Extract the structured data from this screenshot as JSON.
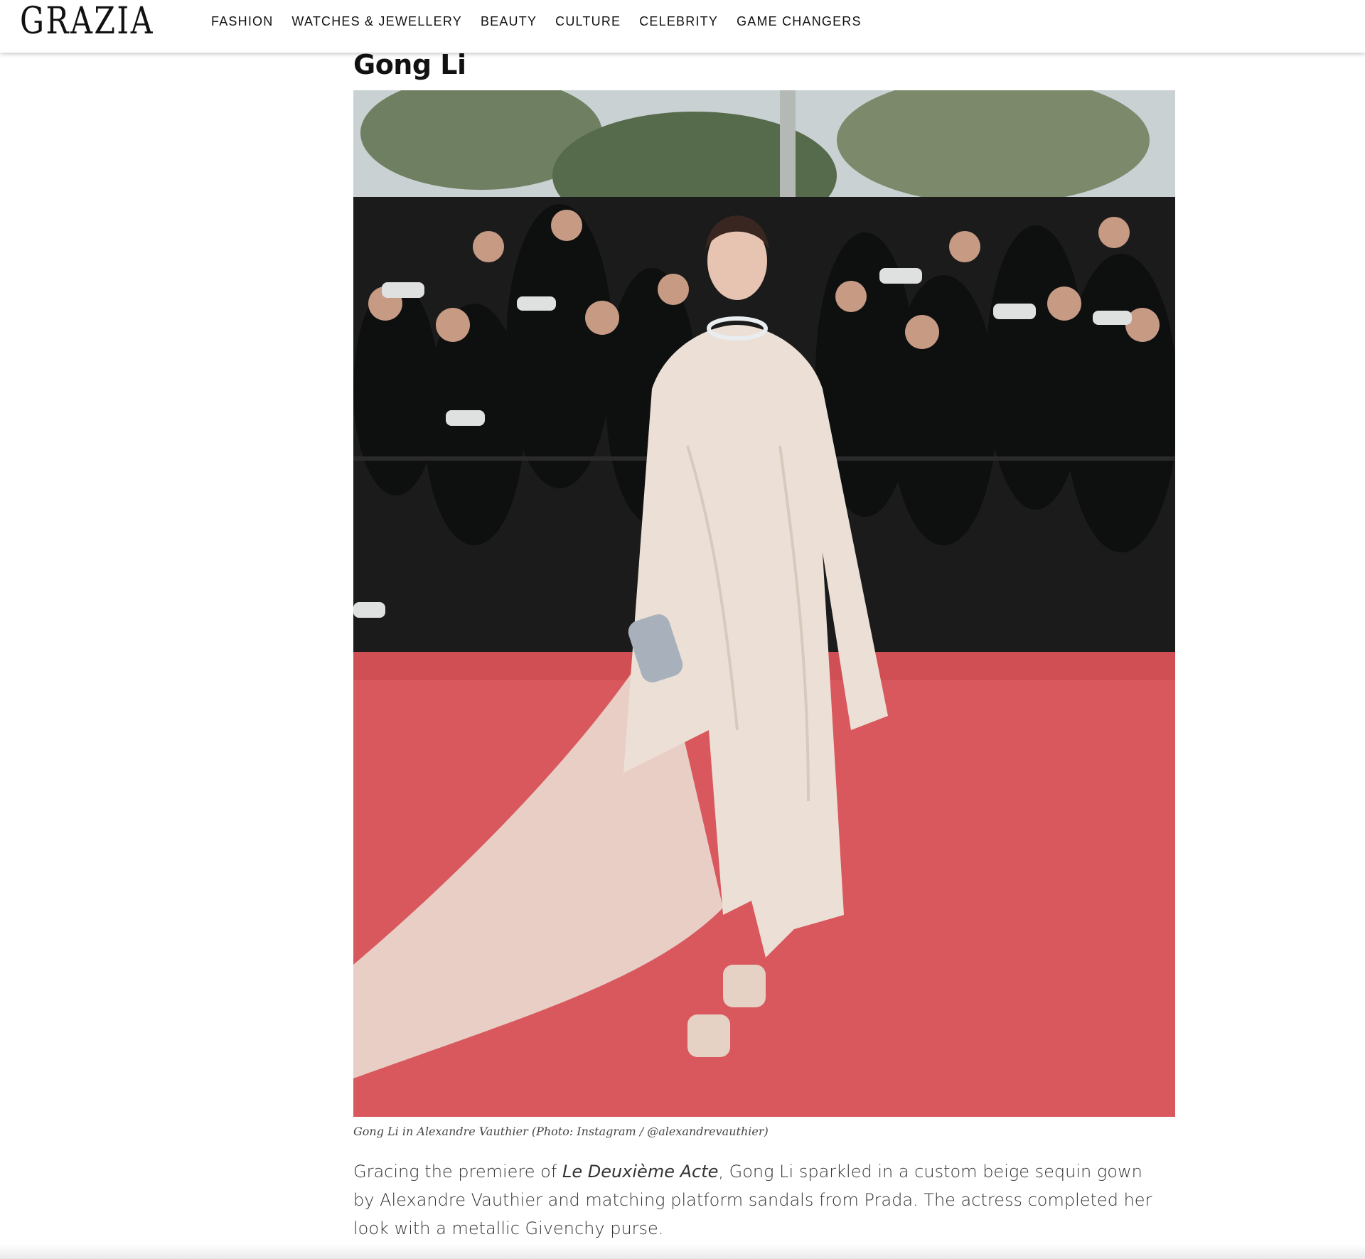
{
  "header": {
    "logo": "GRAZIA",
    "nav": [
      "FASHION",
      "WATCHES & JEWELLERY",
      "BEAUTY",
      "CULTURE",
      "CELEBRITY",
      "GAME CHANGERS"
    ]
  },
  "article": {
    "section_title": "Gong Li",
    "caption": "Gong Li in Alexandre Vauthier (Photo: Instagram / @alexandrevauthier)",
    "body": {
      "before": "Gracing the premiere of ",
      "film_title": "Le Deuxième Acte",
      "after": ", Gong Li sparkled in a custom beige sequin gown by Alexandre Vauthier and matching platform sandals from Prada. The actress completed her look with a metallic Givenchy purse."
    }
  },
  "colors": {
    "red_carpet": "#d8585e",
    "gown": "#ece0d6",
    "crowd": "#1a1b1a"
  }
}
